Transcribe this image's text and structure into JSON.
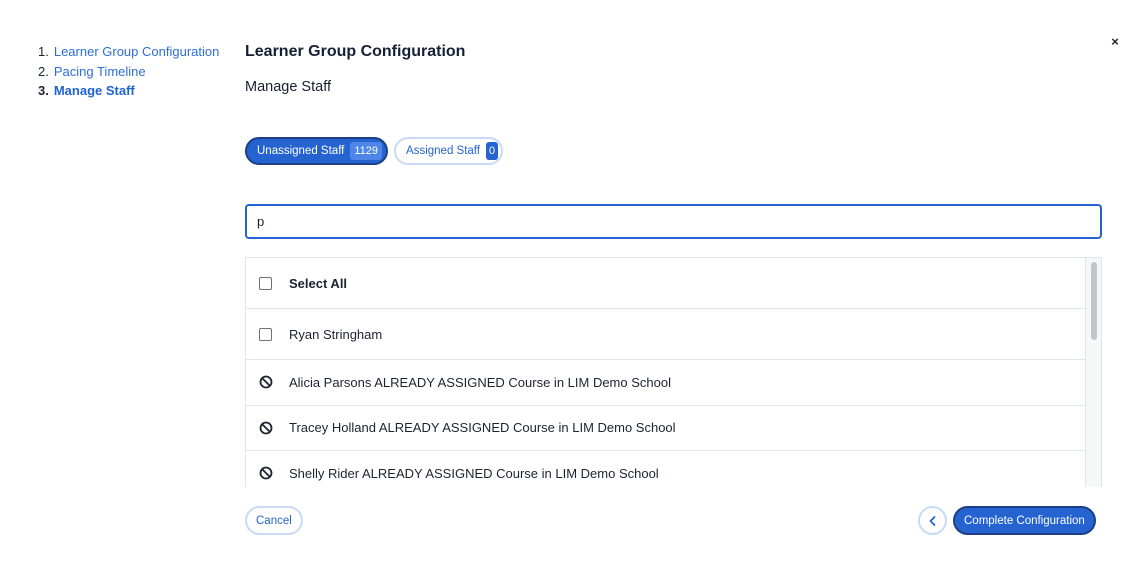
{
  "steps": [
    {
      "num": "1.",
      "label": "Learner Group Configuration"
    },
    {
      "num": "2.",
      "label": "Pacing Timeline"
    },
    {
      "num": "3.",
      "label": "Manage Staff"
    }
  ],
  "close_label": "×",
  "header": {
    "title": "Learner Group Configuration",
    "subtitle": "Manage Staff"
  },
  "tabs": {
    "unassigned": {
      "label": "Unassigned Staff",
      "count": "1129"
    },
    "assigned": {
      "label": "Assigned Staff",
      "count": "0"
    }
  },
  "search": {
    "value": "p"
  },
  "list": {
    "select_all": "Select All",
    "items": [
      "Ryan Stringham"
    ],
    "blocked": [
      "Alicia Parsons ALREADY ASSIGNED Course in LIM Demo School",
      "Tracey Holland ALREADY ASSIGNED Course in LIM Demo School",
      "Shelly Rider ALREADY ASSIGNED Course in LIM Demo School"
    ]
  },
  "footer": {
    "cancel_label": "Cancel",
    "complete_label": "Complete Configuration"
  },
  "colors": {
    "accent": "#2563d1",
    "link": "#2d6fd6"
  }
}
